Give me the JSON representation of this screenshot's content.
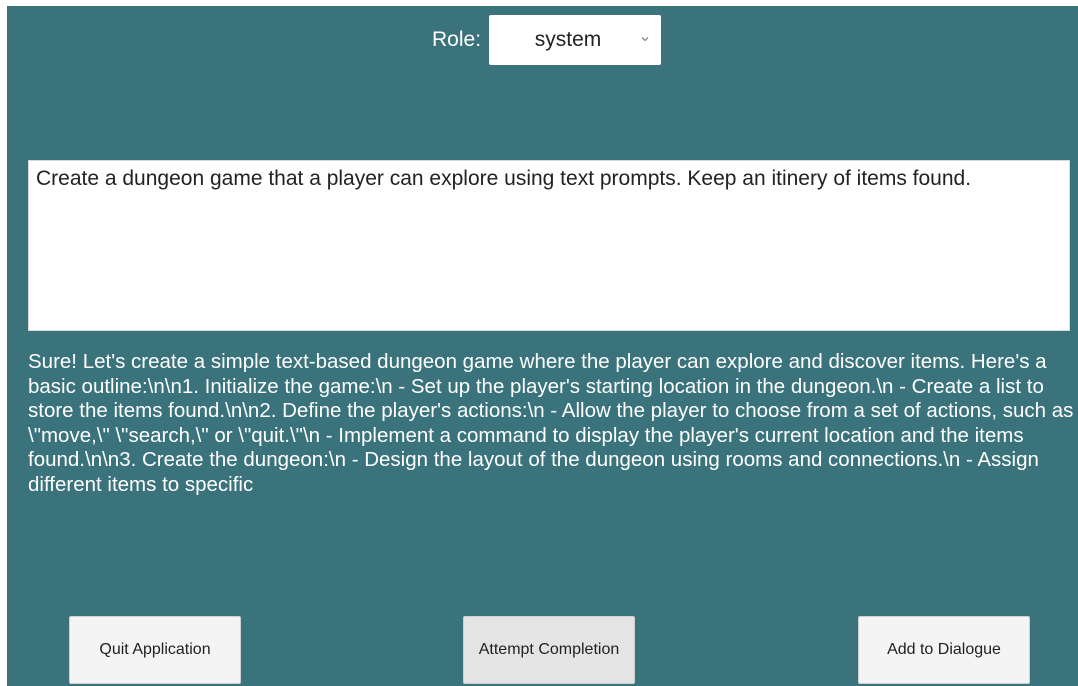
{
  "role": {
    "label": "Role:",
    "selected": "system",
    "chevron_icon": "chevron-down-icon"
  },
  "prompt": {
    "value": "Create a dungeon game that a player can explore using text prompts. Keep an itinery of items found."
  },
  "response": {
    "text": "Sure! Let's create a simple text-based dungeon game where the player can explore and discover items. Here's a basic outline:\\n\\n1. Initialize the game:\\n   - Set up the player's starting location in the dungeon.\\n   - Create a list to store the items found.\\n\\n2. Define the player's actions:\\n   - Allow the player to choose from a set of actions, such as \\\"move,\\\" \\\"search,\\\" or \\\"quit.\\\"\\n   - Implement a command to display the player's current location and the items found.\\n\\n3. Create the dungeon:\\n   - Design the layout of the dungeon using rooms and connections.\\n   - Assign different items to specific"
  },
  "buttons": {
    "quit": "Quit Application",
    "attempt": "Attempt Completion",
    "add": "Add to Dialogue"
  },
  "colors": {
    "background": "#3a737b",
    "text_light": "#ffffff",
    "button_bg": "#f4f4f4"
  }
}
